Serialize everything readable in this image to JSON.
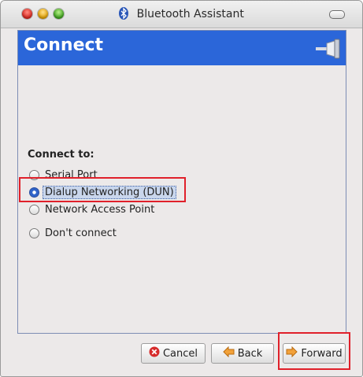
{
  "window": {
    "title": "Bluetooth Assistant"
  },
  "header": {
    "title": "Connect",
    "icon": "plug-icon"
  },
  "connect": {
    "label": "Connect to:",
    "options": [
      {
        "label": "Serial Port",
        "checked": false
      },
      {
        "label": "Dialup Networking (DUN)",
        "checked": true
      },
      {
        "label": "Network Access Point",
        "checked": false
      },
      {
        "label": "Don't connect",
        "checked": false
      }
    ]
  },
  "buttons": {
    "cancel": "Cancel",
    "back": "Back",
    "forward": "Forward"
  },
  "colors": {
    "header_bg": "#2b66d9",
    "highlight": "#e0202a"
  }
}
